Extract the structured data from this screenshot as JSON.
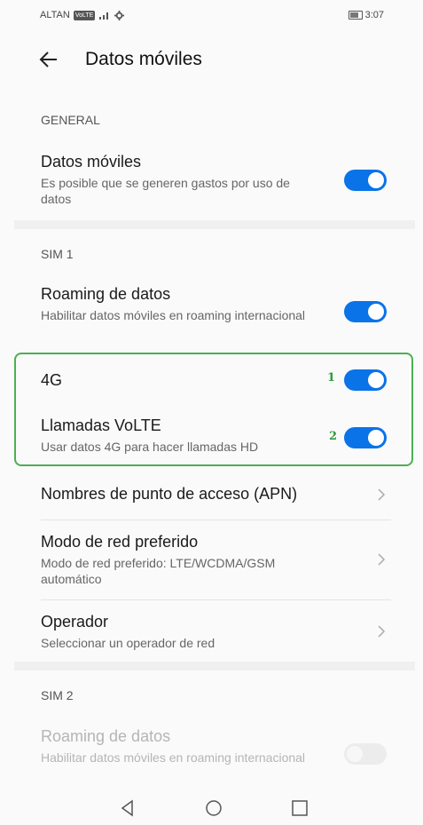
{
  "status_bar": {
    "carrier": "ALTAN",
    "volte_badge": "VoLTE",
    "time": "3:07"
  },
  "header": {
    "title": "Datos móviles"
  },
  "general": {
    "label": "GENERAL",
    "mobile_data": {
      "title": "Datos móviles",
      "subtitle": "Es posible que se generen gastos por uso de datos",
      "enabled": true
    }
  },
  "sim1": {
    "label": "SIM 1",
    "roaming": {
      "title": "Roaming de datos",
      "subtitle": "Habilitar datos móviles en roaming internacional",
      "enabled": true
    },
    "lte": {
      "title": "4G",
      "enabled": true,
      "marker": "1"
    },
    "volte": {
      "title": "Llamadas VoLTE",
      "subtitle": "Usar datos 4G para hacer llamadas HD",
      "enabled": true,
      "marker": "2"
    },
    "apn": {
      "title": "Nombres de punto de acceso (APN)"
    },
    "network_mode": {
      "title": "Modo de red preferido",
      "subtitle": "Modo de red preferido: LTE/WCDMA/GSM automático"
    },
    "operator": {
      "title": "Operador",
      "subtitle": "Seleccionar un operador de red"
    }
  },
  "sim2": {
    "label": "SIM 2",
    "roaming": {
      "title": "Roaming de datos",
      "subtitle": "Habilitar datos móviles en roaming internacional",
      "enabled": false
    }
  },
  "colors": {
    "toggle_on": "#0a73e8",
    "highlight": "#4caf50",
    "marker": "#2e9b3a"
  }
}
